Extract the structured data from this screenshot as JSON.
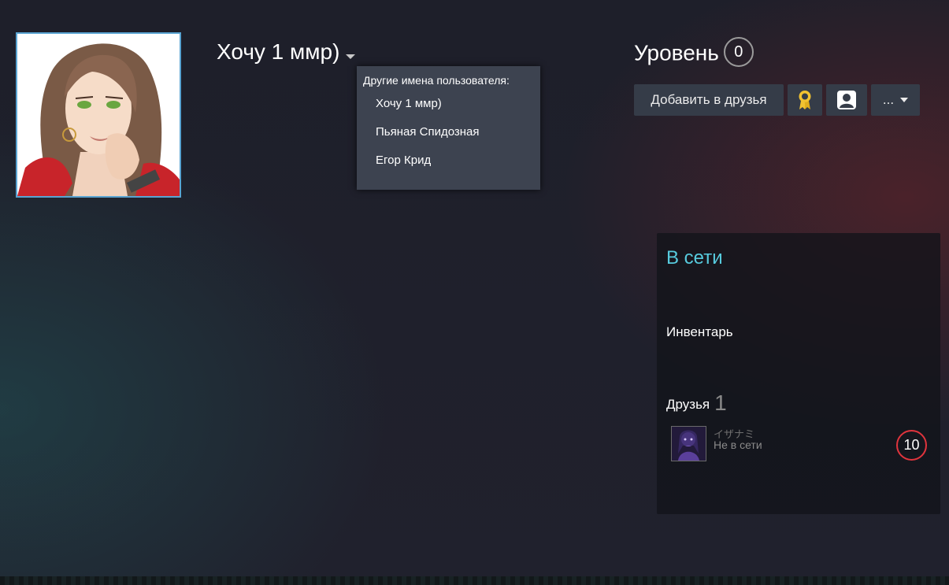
{
  "profile": {
    "persona_name": "Хочу 1 ммр)",
    "level_label": "Уровень",
    "level_value": "0"
  },
  "alias_menu": {
    "title": "Другие имена пользователя:",
    "items": [
      "Хочу 1 ммр)",
      "Пьяная Спидозная",
      "Егор Крид"
    ]
  },
  "actions": {
    "add_friend_label": "Добавить в друзья",
    "more_label": "..."
  },
  "panel": {
    "status": "В сети",
    "inventory_label": "Инвентарь",
    "friends_label": "Друзья",
    "friends_count": "1",
    "friends": [
      {
        "name": "イザナミ",
        "status": "Не в сети",
        "level": "10"
      }
    ]
  },
  "icons": {
    "persona_dropdown": "caret-down-icon",
    "badge": "award-ribbon-icon",
    "profile": "user-silhouette-icon",
    "more": "caret-down-icon"
  },
  "colors": {
    "status_online": "#57cbde",
    "avatar_border": "#5aa4d2",
    "friend_level_ring": "#e0343d",
    "button_bg": "#353c48",
    "dropdown_bg": "#3d4350",
    "badge_gold": "#f2c230"
  }
}
